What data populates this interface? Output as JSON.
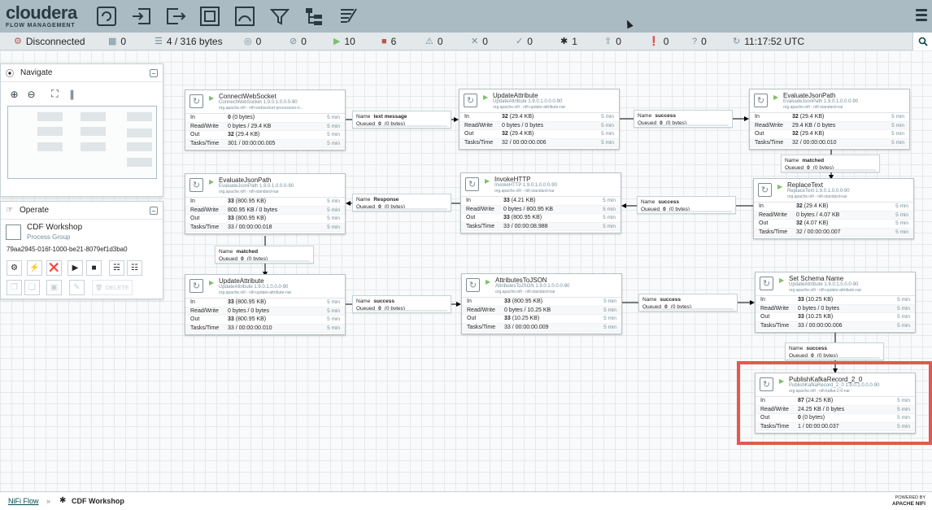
{
  "header": {
    "logo_main": "cloudera",
    "logo_sub": "FLOW MANAGEMENT",
    "toolbar_icons": [
      "processor-icon",
      "input-port-icon",
      "output-port-icon",
      "process-group-icon",
      "remote-process-group-icon",
      "funnel-icon",
      "template-icon",
      "label-icon"
    ]
  },
  "status": {
    "connection": "Disconnected",
    "active_threads": "0",
    "queued": "4 / 316 bytes",
    "transmitting": "0",
    "not_transmitting": "0",
    "running": "10",
    "stopped": "6",
    "invalid": "0",
    "disabled": "0",
    "up_to_date": "0",
    "locally_modified": "1",
    "stale": "0",
    "locally_modified_stale": "0",
    "sync_failure": "0",
    "refreshed": "11:17:52 UTC"
  },
  "navigate": {
    "title": "Navigate"
  },
  "operate": {
    "title": "Operate",
    "name": "CDF Workshop",
    "type": "Process Group",
    "id": "79aa2945-016f-1000-be21-8079ef1d3ba0",
    "delete_label": "DELETE"
  },
  "labels": {
    "in": "In",
    "rw": "Read/Write",
    "out": "Out",
    "tasks": "Tasks/Time",
    "five_min": "5 min",
    "name": "Name",
    "queued": "Queued"
  },
  "processors": [
    {
      "name": "ConnectWebSocket",
      "type": "ConnectWebSocket 1.9.0.1.0.0.0-90",
      "bundle": "org.apache.nifi - nifi-websocket-processors-n...",
      "in": "0",
      "in_b": "(0 bytes)",
      "rw": "0 bytes / 29.4 KB",
      "out": "32",
      "out_b": "(29.4 KB)",
      "tasks": "301 / 00:00:00.005"
    },
    {
      "name": "UpdateAttribute",
      "type": "UpdateAttribute 1.9.0.1.0.0.0-90",
      "bundle": "org.apache.nifi - nifi-update-attribute-nar",
      "in": "32",
      "in_b": "(29.4 KB)",
      "rw": "0 bytes / 0 bytes",
      "out": "32",
      "out_b": "(29.4 KB)",
      "tasks": "32 / 00:00:00.006"
    },
    {
      "name": "EvaluateJsonPath",
      "type": "EvaluateJsonPath 1.9.0.1.0.0.0-90",
      "bundle": "org.apache.nifi - nifi-standard-nar",
      "in": "32",
      "in_b": "(29.4 KB)",
      "rw": "29.4 KB / 0 bytes",
      "out": "32",
      "out_b": "(29.4 KB)",
      "tasks": "32 / 00:00:00.010"
    },
    {
      "name": "EvaluateJsonPath",
      "type": "EvaluateJsonPath 1.9.0.1.0.0.0-90",
      "bundle": "org.apache.nifi - nifi-standard-nar",
      "in": "33",
      "in_b": "(800.95 KB)",
      "rw": "800.95 KB / 0 bytes",
      "out": "33",
      "out_b": "(800.95 KB)",
      "tasks": "33 / 00:00:00.018"
    },
    {
      "name": "InvokeHTTP",
      "type": "InvokeHTTP 1.9.0.1.0.0.0-90",
      "bundle": "org.apache.nifi - nifi-standard-nar",
      "in": "33",
      "in_b": "(4.21 KB)",
      "rw": "0 bytes / 800.95 KB",
      "out": "33",
      "out_b": "(800.95 KB)",
      "tasks": "33 / 00:00:08.988"
    },
    {
      "name": "ReplaceText",
      "type": "ReplaceText 1.9.0.1.0.0.0-90",
      "bundle": "org.apache.nifi - nifi-standard-nar",
      "in": "32",
      "in_b": "(29.4 KB)",
      "rw": "0 bytes / 4.07 KB",
      "out": "32",
      "out_b": "(4.07 KB)",
      "tasks": "32 / 00:00:00.007"
    },
    {
      "name": "UpdateAttribute",
      "type": "UpdateAttribute 1.9.0.1.0.0.0-90",
      "bundle": "org.apache.nifi - nifi-update-attribute-nar",
      "in": "33",
      "in_b": "(800.95 KB)",
      "rw": "0 bytes / 0 bytes",
      "out": "33",
      "out_b": "(800.95 KB)",
      "tasks": "33 / 00:00:00.010"
    },
    {
      "name": "AttributesToJSON",
      "type": "AttributesToJSON 1.9.0.1.0.0.0-90",
      "bundle": "org.apache.nifi - nifi-standard-nar",
      "in": "33",
      "in_b": "(800.95 KB)",
      "rw": "0 bytes / 10.25 KB",
      "out": "33",
      "out_b": "(10.25 KB)",
      "tasks": "33 / 00:00:00.009"
    },
    {
      "name": "Set Schema Name",
      "type": "UpdateAttribute 1.9.0.1.0.0.0-90",
      "bundle": "org.apache.nifi - nifi-update-attribute-nar",
      "in": "33",
      "in_b": "(10.25 KB)",
      "rw": "0 bytes / 0 bytes",
      "out": "33",
      "out_b": "(10.25 KB)",
      "tasks": "33 / 00:00:00.006"
    },
    {
      "name": "PublishKafkaRecord_2_0",
      "type": "PublishKafkaRecord_2_0 1.9.0.1.0.0.0-90",
      "bundle": "org.apache.nifi - nifi-kafka-2-0-nar",
      "in": "87",
      "in_b": "(24.25 KB)",
      "rw": "24.25 KB / 0 bytes",
      "out": "0",
      "out_b": "(0 bytes)",
      "tasks": "1 / 00:00:00.037"
    }
  ],
  "connections": [
    {
      "name": "text message",
      "queued": "0",
      "queued_b": "(0 bytes)"
    },
    {
      "name": "success",
      "queued": "0",
      "queued_b": "(0 bytes)"
    },
    {
      "name": "matched",
      "queued": "0",
      "queued_b": "(0 bytes)"
    },
    {
      "name": "success",
      "queued": "0",
      "queued_b": "(0 bytes)"
    },
    {
      "name": "Response",
      "queued": "0",
      "queued_b": "(0 bytes)"
    },
    {
      "name": "matched",
      "queued": "0",
      "queued_b": "(0 bytes)"
    },
    {
      "name": "success",
      "queued": "0",
      "queued_b": "(0 bytes)"
    },
    {
      "name": "success",
      "queued": "0",
      "queued_b": "(0 bytes)"
    },
    {
      "name": "success",
      "queued": "0",
      "queued_b": "(0 bytes)"
    }
  ],
  "footer": {
    "crumb_root": "NiFi Flow",
    "crumb_sep": "»",
    "crumb_current": "CDF Workshop",
    "powered_by": "POWERED BY",
    "apache_nifi": "APACHE NIFI"
  },
  "colors": {
    "header_bg": "#aabbc3",
    "running": "#7dc06c",
    "stopped": "#ba554a",
    "highlight": "#e05a4f"
  }
}
